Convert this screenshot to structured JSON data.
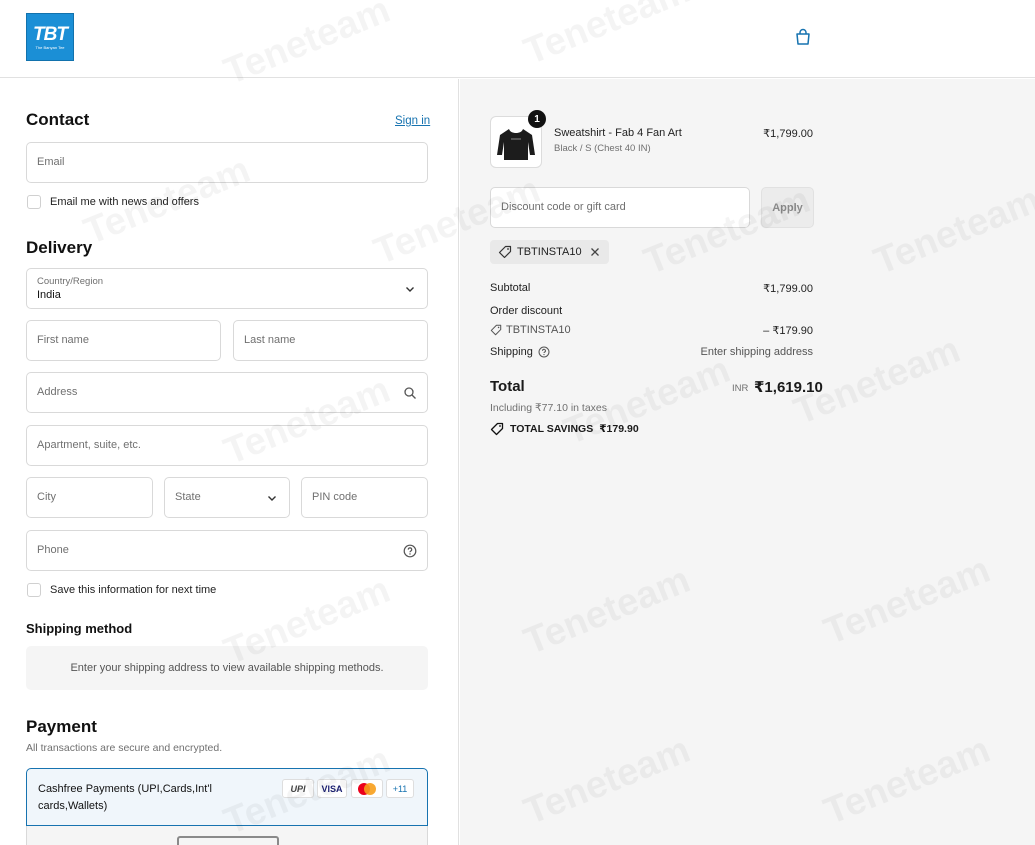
{
  "header": {
    "logo_text": "TBT",
    "logo_tagline": "The Banyan Tee",
    "bag_icon": "shopping-bag-icon",
    "accent": "#1b8fd6"
  },
  "contact": {
    "title": "Contact",
    "sign_in": "Sign in",
    "email_placeholder": "Email",
    "news_label": "Email me with news and offers"
  },
  "delivery": {
    "title": "Delivery",
    "country_label": "Country/Region",
    "country_value": "India",
    "first_name_placeholder": "First name",
    "last_name_placeholder": "Last name",
    "address_placeholder": "Address",
    "apartment_placeholder": "Apartment, suite, etc.",
    "city_placeholder": "City",
    "state_placeholder": "State",
    "pin_placeholder": "PIN code",
    "phone_placeholder": "Phone",
    "save_label": "Save this information for next time"
  },
  "shipping": {
    "title": "Shipping method",
    "message": "Enter your shipping address to view available shipping methods."
  },
  "payment": {
    "title": "Payment",
    "subtitle": "All transactions are secure and encrypted.",
    "method_label": "Cashfree Payments (UPI,Cards,Int'l cards,Wallets)",
    "badges": {
      "upi": "UPI",
      "visa": "VISA",
      "more": "+11"
    }
  },
  "summary": {
    "item": {
      "quantity": "1",
      "name": "Sweatshirt - Fab 4 Fan Art",
      "variant": "Black / S (Chest 40 IN)",
      "price": "₹1,799.00"
    },
    "discount_placeholder": "Discount code or gift card",
    "apply_label": "Apply",
    "applied_code": "TBTINSTA10",
    "subtotal_label": "Subtotal",
    "subtotal_value": "₹1,799.00",
    "order_discount_label": "Order discount",
    "discount_code": "TBTINSTA10",
    "discount_value": "– ₹179.90",
    "shipping_label": "Shipping",
    "shipping_value": "Enter shipping address",
    "total_label": "Total",
    "currency": "INR",
    "total_value": "₹1,619.10",
    "tax_note": "Including ₹77.10 in taxes",
    "savings_label": "TOTAL SAVINGS",
    "savings_value": "₹179.90"
  },
  "watermark": "Teneteam"
}
